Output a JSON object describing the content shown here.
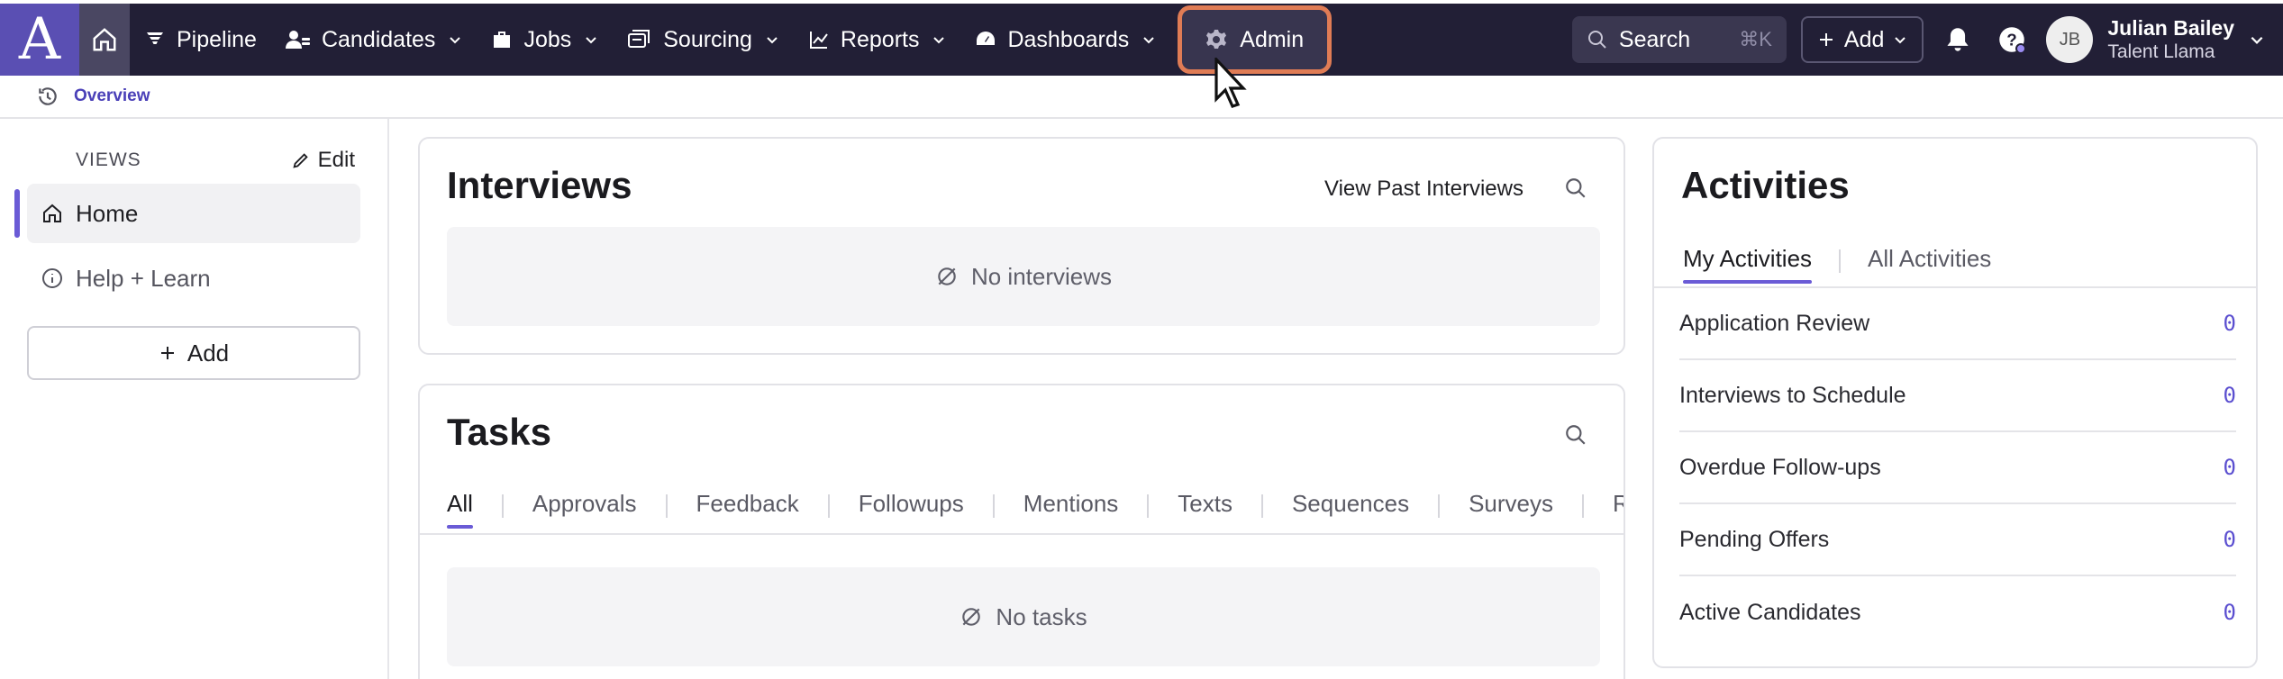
{
  "nav": {
    "logo_letter": "A",
    "items": [
      {
        "label": "Pipeline",
        "icon": "filter-icon"
      },
      {
        "label": "Candidates",
        "icon": "people-icon"
      },
      {
        "label": "Jobs",
        "icon": "briefcase-icon"
      },
      {
        "label": "Sourcing",
        "icon": "sourcing-icon"
      },
      {
        "label": "Reports",
        "icon": "chart-icon"
      },
      {
        "label": "Dashboards",
        "icon": "gauge-icon"
      }
    ],
    "admin_label": "Admin",
    "search_label": "Search",
    "search_shortcut": "⌘K",
    "add_label": "Add",
    "user": {
      "initials": "JB",
      "name": "Julian Bailey",
      "org": "Talent Llama"
    }
  },
  "breadcrumb": {
    "label": "Overview"
  },
  "sidebar": {
    "views_label": "VIEWS",
    "edit_label": "Edit",
    "home_label": "Home",
    "help_label": "Help + Learn",
    "add_label": "Add"
  },
  "interviews": {
    "title": "Interviews",
    "view_past_label": "View Past Interviews",
    "empty_text": "No interviews"
  },
  "tasks": {
    "title": "Tasks",
    "tabs": [
      "All",
      "Approvals",
      "Feedback",
      "Followups",
      "Mentions",
      "Texts",
      "Sequences",
      "Surveys",
      "Re"
    ],
    "empty_text": "No tasks"
  },
  "activities": {
    "title": "Activities",
    "tabs": [
      "My Activities",
      "All Activities"
    ],
    "rows": [
      {
        "label": "Application Review",
        "count": "0"
      },
      {
        "label": "Interviews to Schedule",
        "count": "0"
      },
      {
        "label": "Overdue Follow-ups",
        "count": "0"
      },
      {
        "label": "Pending Offers",
        "count": "0"
      },
      {
        "label": "Active Candidates",
        "count": "0"
      }
    ]
  },
  "colors": {
    "nav_bg": "#221f36",
    "accent": "#6a5bd6",
    "highlight": "#e07c55"
  }
}
